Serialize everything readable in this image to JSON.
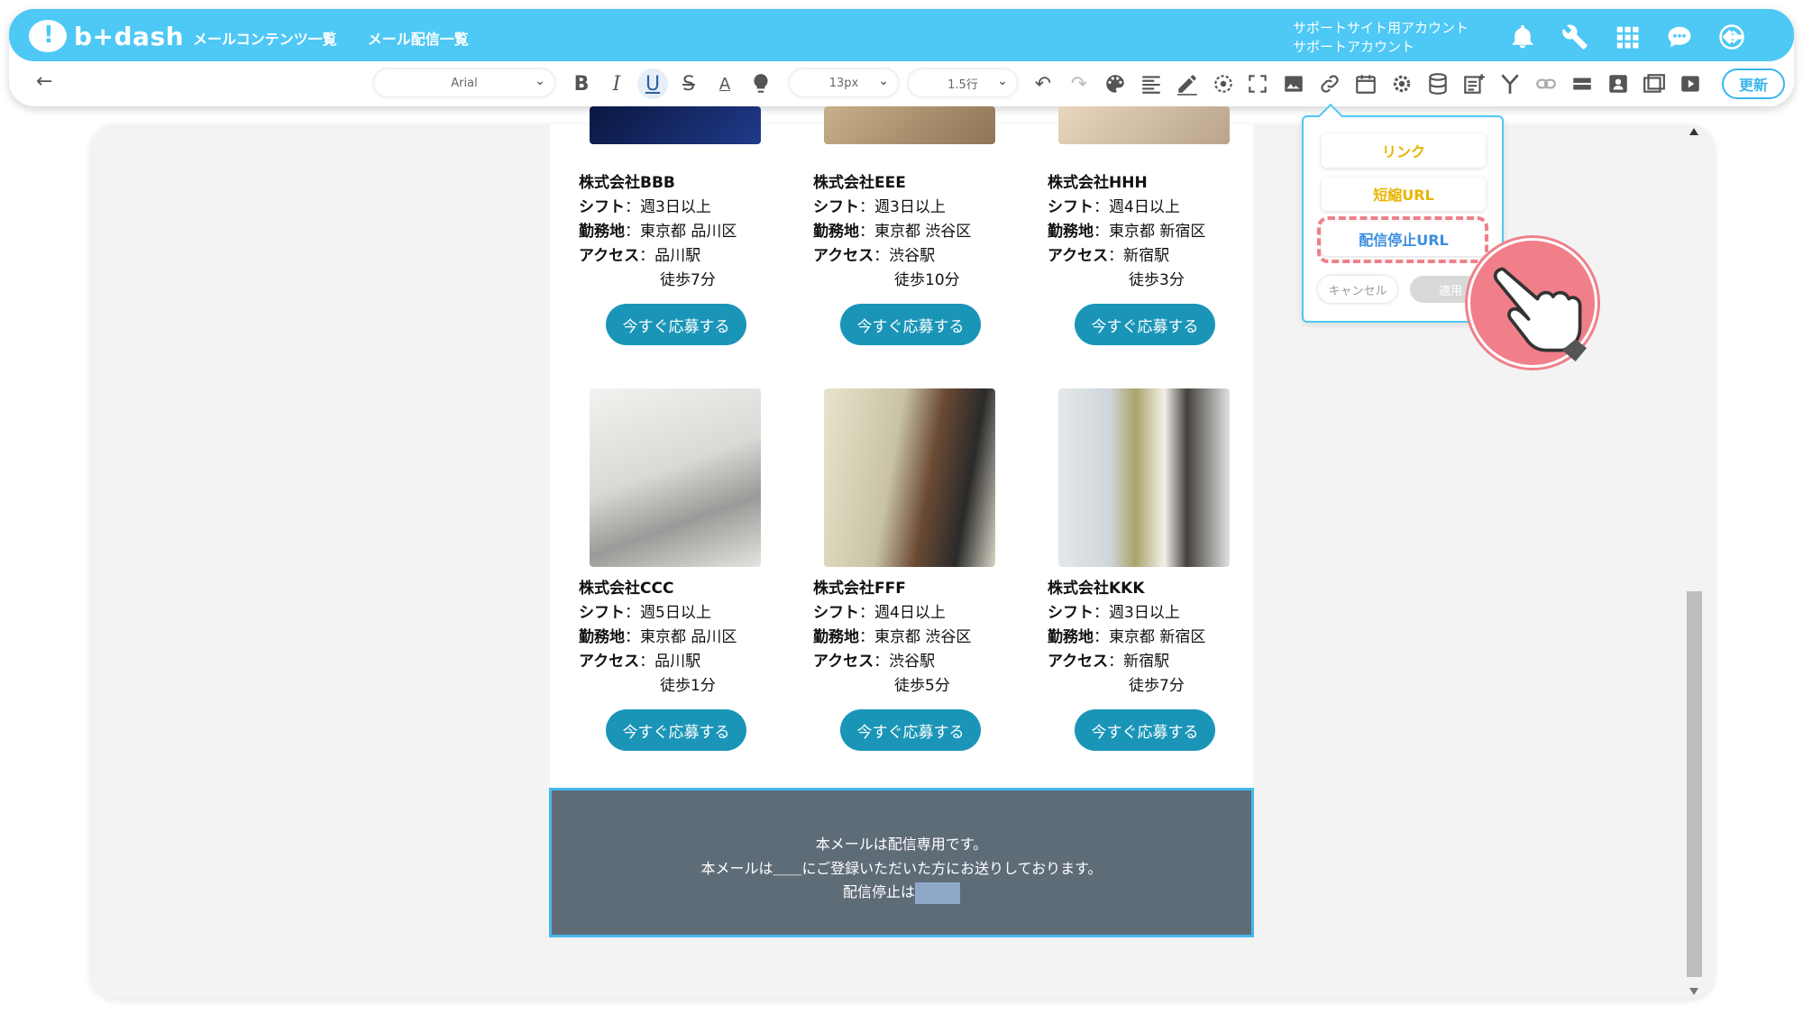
{
  "header": {
    "logo_text": "b+dash",
    "nav": [
      "メールコンテンツ一覧",
      "メール配信一覧"
    ],
    "account_line1": "サポートサイト用アカウント",
    "account_line2": "サポートアカウント",
    "icons": [
      "bell-icon",
      "wrench-icon",
      "apps-grid-icon",
      "chat-icon",
      "logout-icon"
    ]
  },
  "toolbar": {
    "font_family": "Arial",
    "font_size": "13px",
    "line_height": "1.5行",
    "update_label": "更新",
    "buttons": [
      "bold-icon",
      "italic-icon",
      "underline-icon",
      "strikethrough-icon",
      "font-color-icon",
      "highlight-icon",
      "undo-icon",
      "redo-icon",
      "palette-icon",
      "align-icon",
      "pen-icon",
      "target-icon",
      "fullscreen-icon",
      "image-icon",
      "link-icon",
      "calendar-icon",
      "settings-icon",
      "database-icon",
      "note-icon",
      "branch-icon",
      "chain-icon",
      "divider-icon",
      "contact-card-icon",
      "template-icon",
      "video-icon"
    ]
  },
  "cards": [
    {
      "company": "株式会社BBB",
      "shift_label": "シフト",
      "shift": "：週3日以上",
      "loc_label": "勤務地",
      "loc": "：東京都 品川区",
      "access_label": "アクセス",
      "access": "：品川駅",
      "walk": "徒歩7分",
      "button": "今すぐ応募する"
    },
    {
      "company": "株式会社EEE",
      "shift_label": "シフト",
      "shift": "：週3日以上",
      "loc_label": "勤務地",
      "loc": "：東京都 渋谷区",
      "access_label": "アクセス",
      "access": "：渋谷駅",
      "walk": "徒歩10分",
      "button": "今すぐ応募する"
    },
    {
      "company": "株式会社HHH",
      "shift_label": "シフト",
      "shift": "：週4日以上",
      "loc_label": "勤務地",
      "loc": "：東京都 新宿区",
      "access_label": "アクセス",
      "access": "：新宿駅",
      "walk": "徒歩3分",
      "button": "今すぐ応募する"
    },
    {
      "company": "株式会社CCC",
      "shift_label": "シフト",
      "shift": "：週5日以上",
      "loc_label": "勤務地",
      "loc": "：東京都 品川区",
      "access_label": "アクセス",
      "access": "：品川駅",
      "walk": "徒歩1分",
      "button": "今すぐ応募する"
    },
    {
      "company": "株式会社FFF",
      "shift_label": "シフト",
      "shift": "：週4日以上",
      "loc_label": "勤務地",
      "loc": "：東京都 渋谷区",
      "access_label": "アクセス",
      "access": "：渋谷駅",
      "walk": "徒歩5分",
      "button": "今すぐ応募する"
    },
    {
      "company": "株式会社KKK",
      "shift_label": "シフト",
      "shift": "：週3日以上",
      "loc_label": "勤務地",
      "loc": "：東京都 新宿区",
      "access_label": "アクセス",
      "access": "：新宿駅",
      "walk": "徒歩7分",
      "button": "今すぐ応募する"
    }
  ],
  "footer": {
    "line1": "本メールは配信専用です。",
    "line2": "本メールは＿＿にご登録いただいた方にお送りしております。",
    "line3": "配信停止は"
  },
  "popup": {
    "link": "リンク",
    "short_url": "短縮URL",
    "unsubscribe_url": "配信停止URL",
    "cancel": "キャンセル",
    "apply": "適用"
  },
  "colors": {
    "brand": "#4ec8f5",
    "apply_button": "#1a95b8",
    "footer_bg": "#5e6c78",
    "annotation": "#f07f89"
  }
}
